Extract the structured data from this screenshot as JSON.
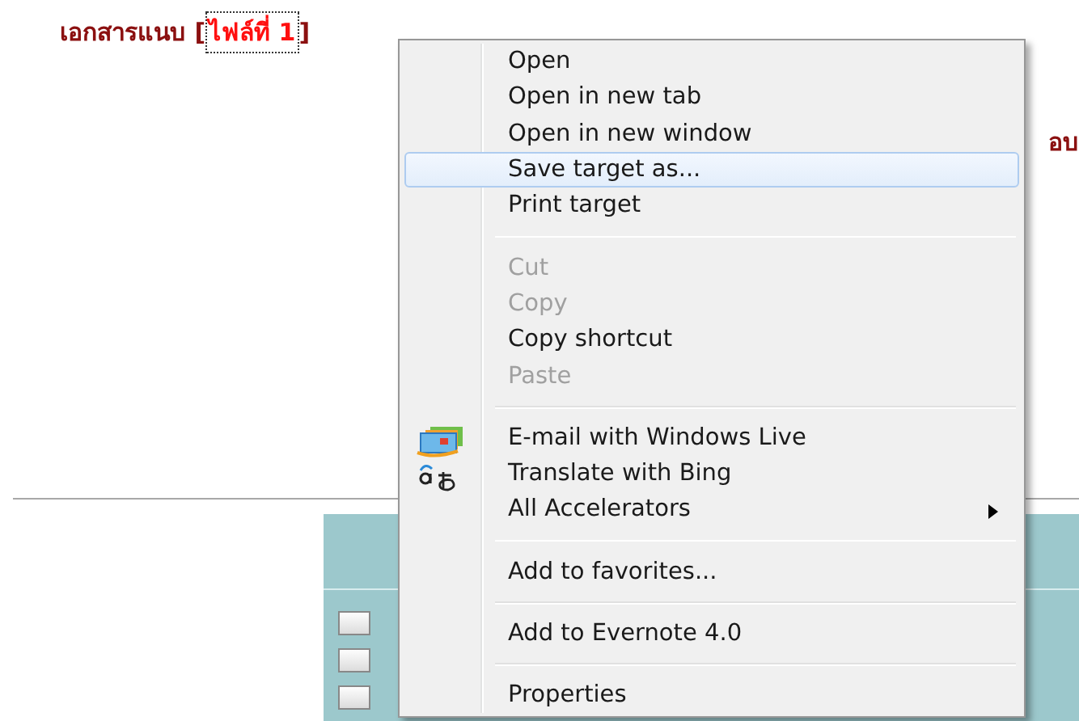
{
  "page": {
    "attachments_label": "เอกสารแนบ [",
    "attachment_link": "ไฟล์ที่ 1",
    "attachments_close": "]",
    "cut_text": "อบ",
    "table": {
      "checkboxes": [
        {
          "checked": false
        },
        {
          "checked": false
        },
        {
          "checked": false
        }
      ]
    }
  },
  "context_menu": {
    "items": [
      {
        "kind": "plain",
        "label": "Open",
        "disabled": false,
        "selected": false
      },
      {
        "kind": "plain",
        "label": "Open in new tab",
        "disabled": false,
        "selected": false
      },
      {
        "kind": "plain",
        "label": "Open in new window",
        "disabled": false,
        "selected": false
      },
      {
        "kind": "plain",
        "label": "Save target as...",
        "disabled": false,
        "selected": true
      },
      {
        "kind": "plain",
        "label": "Print target",
        "disabled": false,
        "selected": false
      },
      {
        "kind": "separator"
      },
      {
        "kind": "plain",
        "label": "Cut",
        "disabled": true,
        "selected": false
      },
      {
        "kind": "plain",
        "label": "Copy",
        "disabled": true,
        "selected": false
      },
      {
        "kind": "plain",
        "label": "Copy shortcut",
        "disabled": false,
        "selected": false
      },
      {
        "kind": "plain",
        "label": "Paste",
        "disabled": true,
        "selected": false
      },
      {
        "kind": "separator"
      },
      {
        "kind": "mail",
        "label": "E-mail with Windows Live",
        "disabled": false,
        "selected": false
      },
      {
        "kind": "translate",
        "label": "Translate with Bing",
        "disabled": false,
        "selected": false
      },
      {
        "kind": "submenu",
        "label": "All Accelerators",
        "disabled": false,
        "selected": false
      },
      {
        "kind": "separator"
      },
      {
        "kind": "plain",
        "label": "Add to favorites...",
        "disabled": false,
        "selected": false
      },
      {
        "kind": "separator"
      },
      {
        "kind": "plain",
        "label": "Add to Evernote 4.0",
        "disabled": false,
        "selected": false
      },
      {
        "kind": "separator"
      },
      {
        "kind": "plain",
        "label": "Properties",
        "disabled": false,
        "selected": false
      }
    ]
  }
}
